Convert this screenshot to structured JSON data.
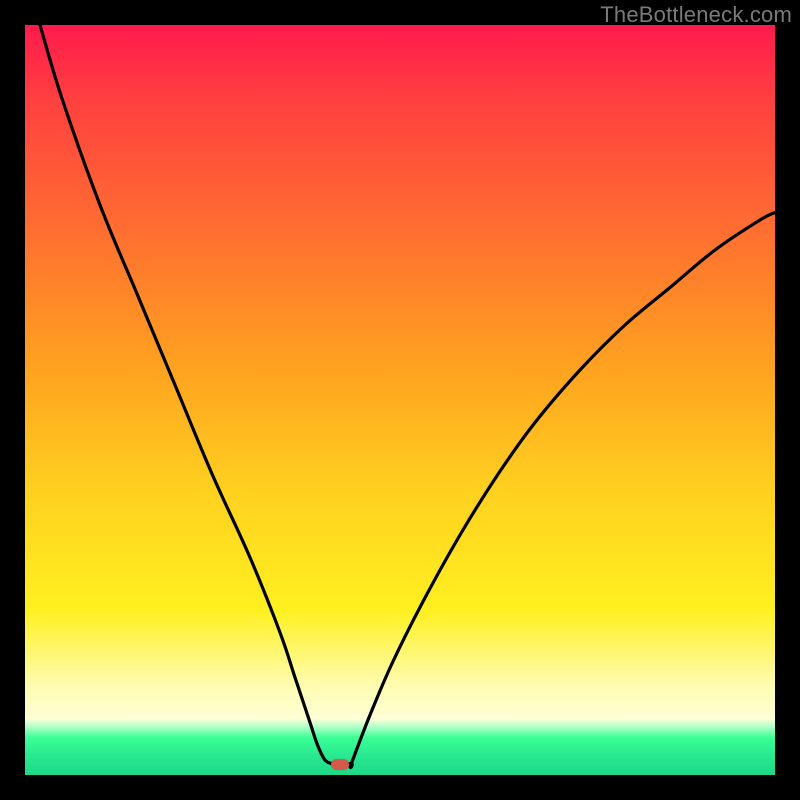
{
  "watermark": {
    "text": "TheBottleneck.com"
  },
  "chart_data": {
    "type": "line",
    "title": "",
    "xlabel": "",
    "ylabel": "",
    "xlim": [
      0,
      100
    ],
    "ylim": [
      0,
      100
    ],
    "grid": false,
    "legend": false,
    "marker": {
      "x": 42,
      "y": 1.5,
      "color": "#d65a4a"
    },
    "series": [
      {
        "name": "left-branch",
        "x": [
          2,
          5,
          10,
          15,
          20,
          25,
          30,
          34,
          36,
          38,
          39,
          40,
          41
        ],
        "values": [
          100,
          90,
          76,
          64,
          52,
          40,
          29,
          19,
          13,
          7,
          4,
          2,
          1.5
        ]
      },
      {
        "name": "floor",
        "x": [
          41,
          43.5
        ],
        "values": [
          1.5,
          1.5
        ]
      },
      {
        "name": "right-branch",
        "x": [
          43.5,
          46,
          49,
          53,
          58,
          63,
          68,
          74,
          80,
          86,
          92,
          98,
          100
        ],
        "values": [
          1.5,
          8,
          15,
          23,
          32,
          40,
          47,
          54,
          60,
          65,
          70,
          74,
          75
        ]
      }
    ],
    "gradient_stops": [
      {
        "pos": 0.0,
        "color": "#ff1a4d"
      },
      {
        "pos": 0.1,
        "color": "#ff4040"
      },
      {
        "pos": 0.28,
        "color": "#ff7030"
      },
      {
        "pos": 0.45,
        "color": "#ffa020"
      },
      {
        "pos": 0.62,
        "color": "#ffd020"
      },
      {
        "pos": 0.78,
        "color": "#fff020"
      },
      {
        "pos": 0.88,
        "color": "#fffcb0"
      },
      {
        "pos": 0.925,
        "color": "#fdffd6"
      },
      {
        "pos": 0.935,
        "color": "#b8ffcc"
      },
      {
        "pos": 0.95,
        "color": "#3cff96"
      },
      {
        "pos": 0.975,
        "color": "#28e890"
      },
      {
        "pos": 1.0,
        "color": "#1ed888"
      }
    ]
  }
}
